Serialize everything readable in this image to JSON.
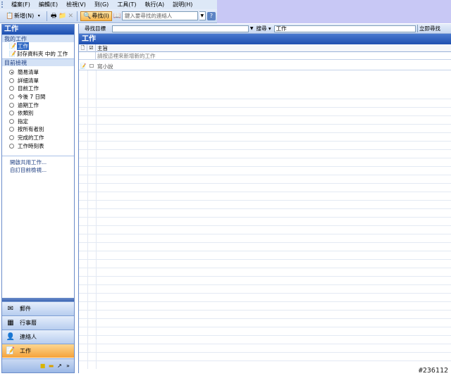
{
  "menubar": {
    "items": [
      "檔案(F)",
      "編輯(E)",
      "檢視(V)",
      "到(G)",
      "工具(T)",
      "執行(A)",
      "說明(H)"
    ]
  },
  "toolbar": {
    "new_label": "新增(N)",
    "find_label": "尋找(I)",
    "contact_search_placeholder": "鍵入要尋找的連絡人"
  },
  "nav": {
    "header": "工作",
    "my_tasks_section": "我的工作",
    "folders": [
      {
        "label": "工作",
        "selected": true
      },
      {
        "label": "封存資料夾 中的 工作",
        "selected": false
      }
    ],
    "current_view_section": "目前檢視",
    "views": [
      {
        "label": "簡易清單",
        "checked": true
      },
      {
        "label": "詳細清單",
        "checked": false
      },
      {
        "label": "目前工作",
        "checked": false
      },
      {
        "label": "今後 7 日間",
        "checked": false
      },
      {
        "label": "逾期工作",
        "checked": false
      },
      {
        "label": "依類別",
        "checked": false
      },
      {
        "label": "指定",
        "checked": false
      },
      {
        "label": "按所有者別",
        "checked": false
      },
      {
        "label": "完成的工作",
        "checked": false
      },
      {
        "label": "工作時刻表",
        "checked": false
      }
    ],
    "links": [
      "開啟共用工作...",
      "自訂目前檢視..."
    ],
    "modules": [
      {
        "label": "郵件",
        "icon": "mail-icon",
        "active": false
      },
      {
        "label": "行事曆",
        "icon": "calendar-icon",
        "active": false
      },
      {
        "label": "連絡人",
        "icon": "contacts-icon",
        "active": false
      },
      {
        "label": "工作",
        "icon": "tasks-icon",
        "active": true
      }
    ]
  },
  "findbar": {
    "find_label": "尋找目標",
    "search_in_label": "搜尋",
    "scope_value": "工作",
    "find_now_label": "立即尋找"
  },
  "main": {
    "title": "工作",
    "subject_header": "主旨",
    "new_task_placeholder": "請按這裡來新增新的工作",
    "tasks": [
      {
        "subject": "寫小說",
        "completed": false
      }
    ]
  },
  "watermark": "#236112"
}
